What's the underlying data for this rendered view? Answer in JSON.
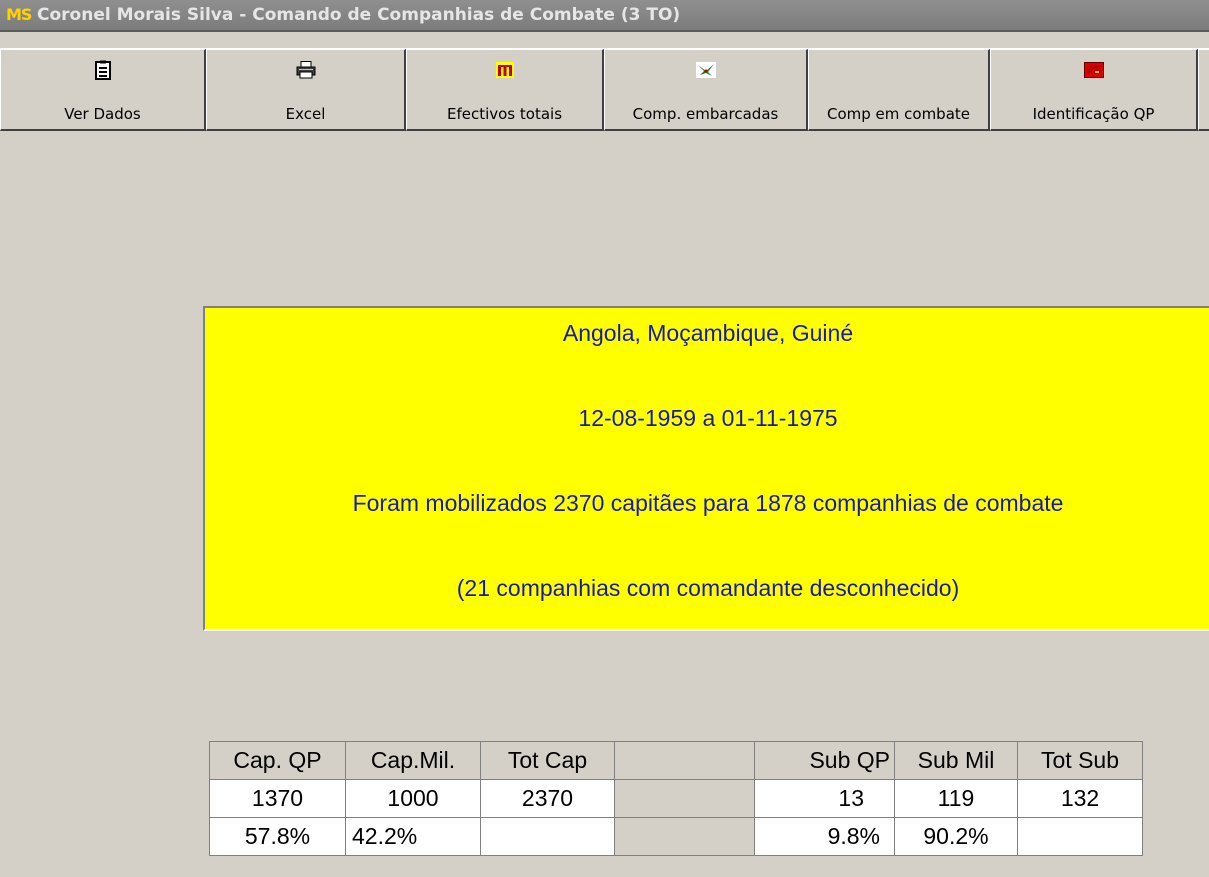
{
  "window": {
    "logo_text": "MS",
    "title": "Coronel Morais Silva  - Comando de Companhias de Combate (3 TO)"
  },
  "toolbar": {
    "buttons": [
      {
        "label": "Ver Dados",
        "icon": "clipboard-icon"
      },
      {
        "label": "Excel",
        "icon": "printer-icon"
      },
      {
        "label": "Efectivos totais",
        "icon": "yellow-chart-icon"
      },
      {
        "label": "Comp. embarcadas",
        "icon": "green-plane-icon"
      },
      {
        "label": "Comp em combate",
        "icon": ""
      },
      {
        "label": "Identificação QP",
        "icon": "red-card-icon"
      }
    ]
  },
  "info": {
    "line1": "Angola, Moçambique, Guiné",
    "line2": "12-08-1959 a 01-11-1975",
    "line3": "Foram mobilizados 2370 capitães para 1878 companhias de combate",
    "line4": "(21 companhias com comandante desconhecido)"
  },
  "stats": {
    "headers": [
      "Cap. QP",
      "Cap.Mil.",
      "Tot Cap",
      "",
      "Sub QP",
      "Sub Mil",
      "Tot Sub"
    ],
    "counts": [
      "1370",
      "1000",
      "2370",
      "",
      "13",
      "119",
      "132"
    ],
    "percents": [
      "57.8%",
      "42.2%",
      "",
      "",
      "9.8%",
      "90.2%",
      ""
    ]
  },
  "colors": {
    "panel_background": "#ffff00",
    "panel_text": "#1a1aa8",
    "window_background": "#d4d0c8"
  }
}
